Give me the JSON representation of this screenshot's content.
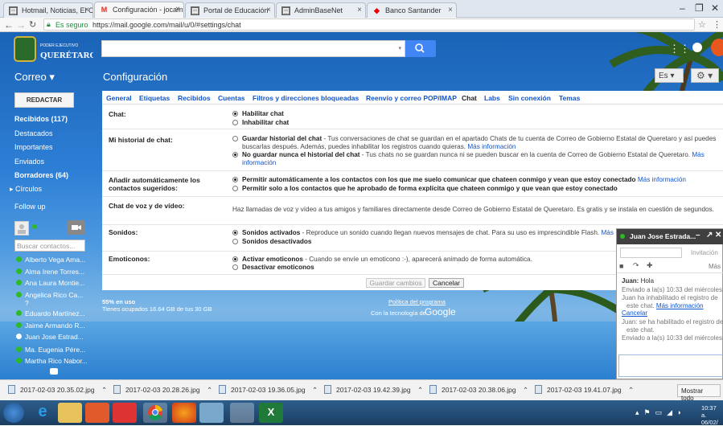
{
  "browser": {
    "tabs": [
      "Hotmail, Noticias, El Cli",
      "Configuración - jocampo",
      "Portal de Educación",
      "AdminBaseNet",
      "Banco Santander"
    ],
    "secure": "Es seguro",
    "url": "https://mail.google.com/mail/u/0/#settings/chat"
  },
  "header": {
    "app": "Correo ▾",
    "page_title": "Configuración",
    "lang": "Es ▾"
  },
  "sidebar": {
    "compose": "REDACTAR",
    "items": [
      "Recibidos (117)",
      "Destacados",
      "Importantes",
      "Enviados",
      "Borradores (64)",
      "▸ Círculos",
      "Follow up"
    ],
    "chat_search": "Buscar contactos...",
    "contacts": [
      "Alberto Vega Ama...",
      "Alma Irene Torres...",
      "Ana Laura Montie...",
      "Angelica Rico Ca...",
      "?",
      "Eduardo Martínez...",
      "Jaime Armando R...",
      "Juan Jose Estrad...",
      "Ma. Eugenia Pére...",
      "Martha Rico Nabor..."
    ]
  },
  "settings": {
    "tabs": [
      "General",
      "Etiquetas",
      "Recibidos",
      "Cuentas",
      "Filtros y direcciones bloqueadas",
      "Reenvío y correo POP/IMAP",
      "Chat",
      "Labs",
      "Sin conexión",
      "Temas"
    ],
    "chat": {
      "label": "Chat:",
      "opt1": "Habilitar chat",
      "opt2": "Inhabilitar chat"
    },
    "history": {
      "label": "Mi historial de chat:",
      "opt1_b": "Guardar historial del chat",
      "opt1_t": " - Tus conversaciones de chat se guardan en el apartado Chats de tu cuenta de Correo de Gobierno Estatal de Queretaro y así puedes buscarlas después. Además, puedes inhabilitar los registros cuando quieras. ",
      "opt1_link": "Más información",
      "opt2_b": "No guardar nunca el historial del chat",
      "opt2_t": " - Tus chats no se guardan nunca ni se pueden buscar en la cuenta de Correo de Gobierno Estatal de Queretaro. ",
      "opt2_link": "Más información"
    },
    "auto": {
      "label1": "Añadir automáticamente los",
      "label2": "contactos sugeridos:",
      "opt1": "Permitir automáticamente a los contactos con los que me suelo comunicar que chateen conmigo y vean que estoy conectado",
      "opt1_link": "Más información",
      "opt2": "Permitir solo a los contactos que he aprobado de forma explícita que chateen conmigo y que vean que estoy conectado"
    },
    "voice": {
      "label": "Chat de voz y de vídeo:",
      "text": "Haz llamadas de voz y vídeo a tus amigos y familiares directamente desde Correo de Gobierno Estatal de Queretaro. Es gratis y se instala en cuestión de segundos."
    },
    "sounds": {
      "label": "Sonidos:",
      "opt1_b": "Sonidos activados",
      "opt1_t": " - Reproduce un sonido cuando llegan nuevos mensajes de chat. Para su uso es imprescindible Flash. ",
      "opt1_link": "Más",
      "opt2": "Sonidos desactivados"
    },
    "emoticons": {
      "label": "Emoticonos:",
      "opt1_b": "Activar emoticonos",
      "opt1_t": " - Cuando se envíe un emoticono :-), aparecerá animado de forma automática.",
      "opt2": "Desactivar emoticonos"
    },
    "save": "Guardar cambios",
    "cancel": "Cancelar"
  },
  "footer": {
    "usage": "55% en uso",
    "storage": "Tienes ocupados 16.64 GB de tus 30 GB",
    "policy": "Política del programa",
    "tech": "Con la tecnología de",
    "google": "Google"
  },
  "chatwin": {
    "name": "Juan Jose Estrada...",
    "invite": "Invitación",
    "more": "Más",
    "m1_name": "Juan:",
    "m1": "Hola",
    "m2": "Enviado a la(s) 10:33 del miércoles",
    "m3": "Juan ha inhabilitado el registro de este chat.",
    "m3_link": "Más información",
    "m3_cancel": "Cancelar",
    "m4": "Juan: se ha habilitado el registro de este chat.",
    "m5": "Enviado a la(s) 10:33 del miércoles"
  },
  "downloads": {
    "files": [
      "2017-02-03 20.35.02.jpg",
      "2017-02-03 20.28.26.jpg",
      "2017-02-03 19.36.05.jpg",
      "2017-02-03 19.42.39.jpg",
      "2017-02-03 20.38.06.jpg",
      "2017-02-03 19.41.07.jpg"
    ],
    "show_all": "Mostrar todo"
  },
  "clock": {
    "time": "10:37 a.",
    "date": "06/02/"
  }
}
